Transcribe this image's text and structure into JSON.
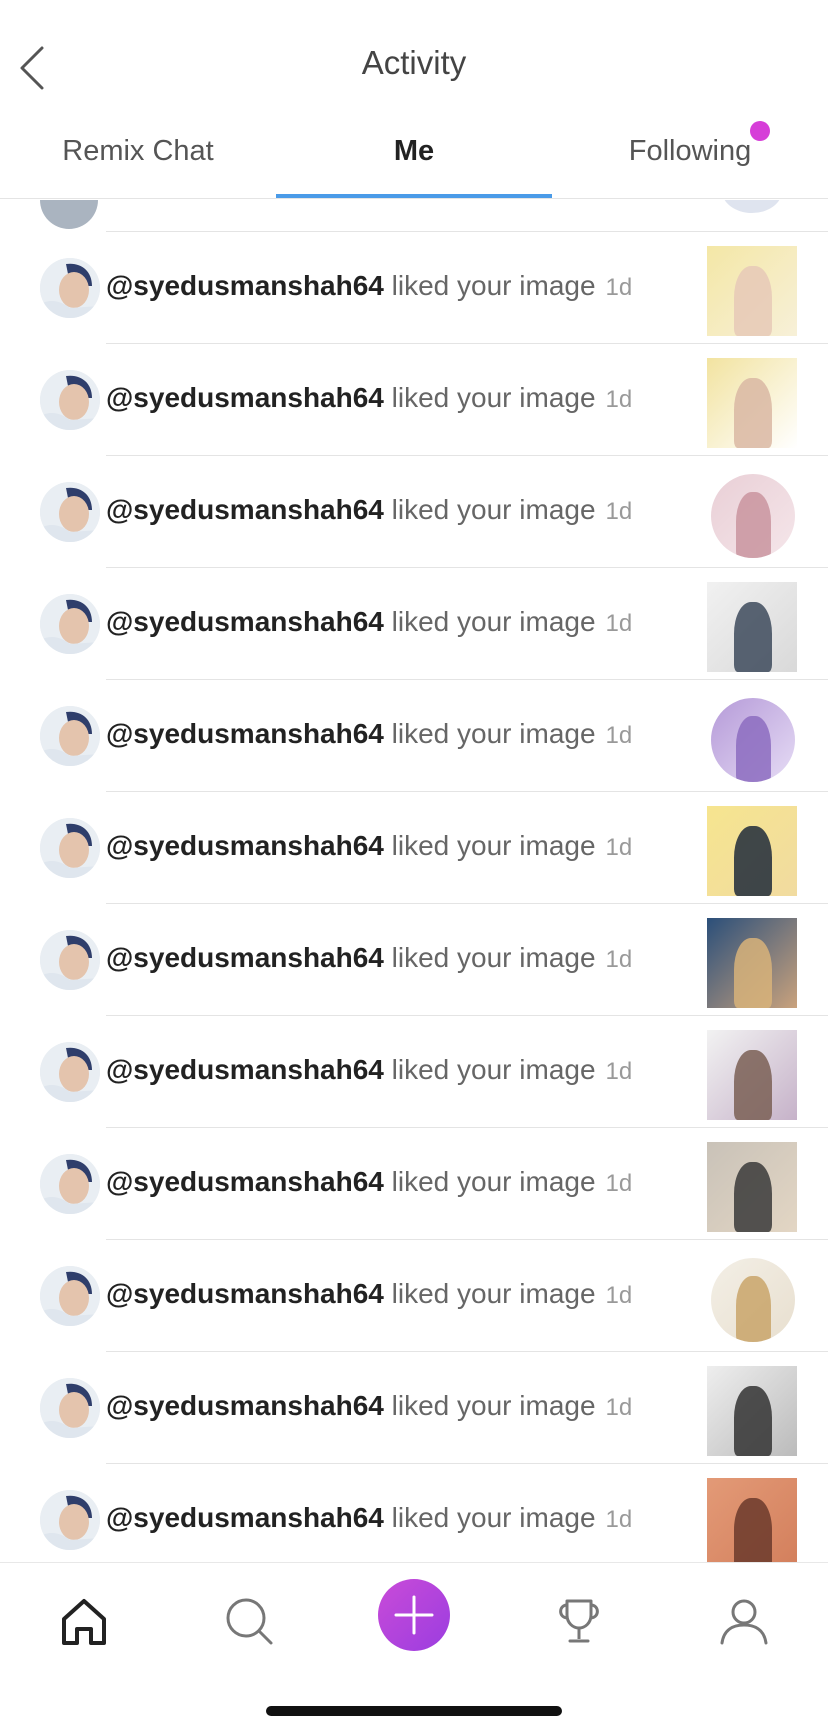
{
  "header": {
    "title": "Activity",
    "tabs": [
      {
        "label": "Remix Chat"
      },
      {
        "label": "Me",
        "active": true
      },
      {
        "label": "Following",
        "has_notification_dot": true
      }
    ]
  },
  "activity": {
    "items": [
      {
        "username": "@syedusmanshah64",
        "action": "liked your image",
        "time": "1d",
        "thumb_shape": "square",
        "thumb_colors": [
          "#f4e7a6",
          "#e6c9b7",
          "#f7f0d8"
        ]
      },
      {
        "username": "@syedusmanshah64",
        "action": "liked your image",
        "time": "1d",
        "thumb_shape": "square",
        "thumb_colors": [
          "#f2e3a0",
          "#d9b7a3",
          "#ffffff"
        ]
      },
      {
        "username": "@syedusmanshah64",
        "action": "liked your image",
        "time": "1d",
        "thumb_shape": "circle",
        "thumb_colors": [
          "#e9cfd6",
          "#c9949f",
          "#f5e6ea"
        ]
      },
      {
        "username": "@syedusmanshah64",
        "action": "liked your image",
        "time": "1d",
        "thumb_shape": "square",
        "thumb_colors": [
          "#f1f1f1",
          "#3d4a5c",
          "#d9d9d9"
        ]
      },
      {
        "username": "@syedusmanshah64",
        "action": "liked your image",
        "time": "1d",
        "thumb_shape": "circle",
        "thumb_colors": [
          "#b59ad8",
          "#8c6cc0",
          "#e6dcf5"
        ]
      },
      {
        "username": "@syedusmanshah64",
        "action": "liked your image",
        "time": "1d",
        "thumb_shape": "square",
        "thumb_colors": [
          "#f6e58f",
          "#1e2a3a",
          "#f1dba0"
        ]
      },
      {
        "username": "@syedusmanshah64",
        "action": "liked your image",
        "time": "1d",
        "thumb_shape": "square",
        "thumb_colors": [
          "#2b4f7a",
          "#d8b37a",
          "#c9a27d"
        ]
      },
      {
        "username": "@syedusmanshah64",
        "action": "liked your image",
        "time": "1d",
        "thumb_shape": "square",
        "thumb_colors": [
          "#f2f2f2",
          "#7a5f55",
          "#c6b2c9"
        ]
      },
      {
        "username": "@syedusmanshah64",
        "action": "liked your image",
        "time": "1d",
        "thumb_shape": "square",
        "thumb_colors": [
          "#c9c2b8",
          "#3a3a3a",
          "#e3d6c4"
        ]
      },
      {
        "username": "@syedusmanshah64",
        "action": "liked your image",
        "time": "1d",
        "thumb_shape": "circle",
        "thumb_colors": [
          "#f3efe6",
          "#c9a56a",
          "#e8dfcf"
        ]
      },
      {
        "username": "@syedusmanshah64",
        "action": "liked your image",
        "time": "1d",
        "thumb_shape": "square",
        "thumb_colors": [
          "#eeeeee",
          "#333333",
          "#bbbbbb"
        ]
      },
      {
        "username": "@syedusmanshah64",
        "action": "liked your image",
        "time": "1d",
        "thumb_shape": "square",
        "thumb_colors": [
          "#e39a77",
          "#6b3a2c",
          "#d37f5c"
        ]
      }
    ]
  },
  "navbar": {
    "items": [
      {
        "icon": "home-icon",
        "active": true
      },
      {
        "icon": "search-icon"
      },
      {
        "icon": "plus-icon"
      },
      {
        "icon": "trophy-icon"
      },
      {
        "icon": "profile-icon"
      }
    ]
  },
  "colors": {
    "accent_blue": "#4a9be8",
    "notification": "#d63ed8",
    "create_gradient_start": "#c94bd8",
    "create_gradient_end": "#9b3de0"
  }
}
